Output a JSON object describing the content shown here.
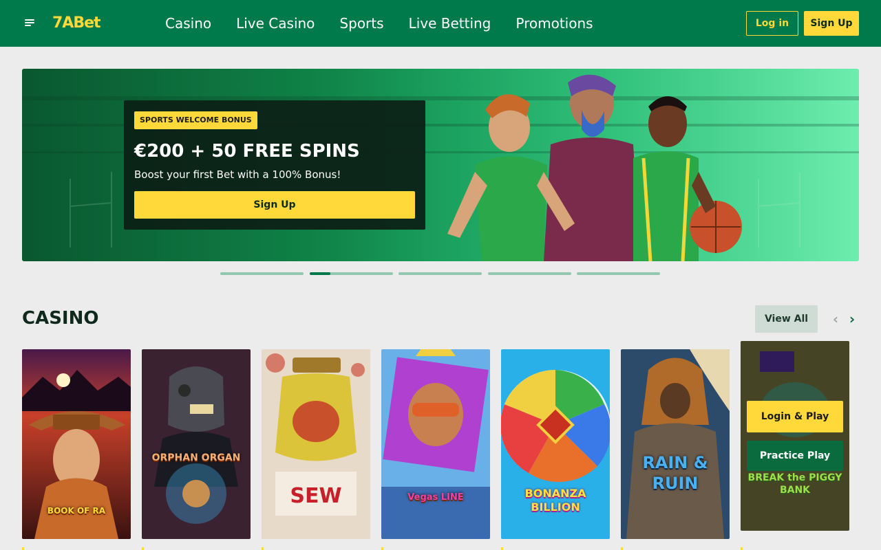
{
  "header": {
    "logo_num": "7A",
    "logo_text": "Bet",
    "nav": [
      "Casino",
      "Live Casino",
      "Sports",
      "Live Betting",
      "Promotions"
    ],
    "login_label": "Log in",
    "signup_label": "Sign Up"
  },
  "banner": {
    "badge": "SPORTS WELCOME BONUS",
    "title": "€200 + 50 FREE SPINS",
    "subtitle": "Boost your first Bet with a 100% Bonus!",
    "cta": "Sign Up",
    "slide_count": 5,
    "active_slide": 2,
    "active_slide_progress": 0.25
  },
  "casino": {
    "title": "CASINO",
    "view_all": "View All",
    "games": [
      {
        "name": "BOOK OF RA",
        "bg": "#7a2a2a"
      },
      {
        "name": "ORPHAN ORGAN",
        "bg": "#3a2230"
      },
      {
        "name": "SEW",
        "bg": "#e8dac8"
      },
      {
        "name": "Vegas LINE",
        "bg": "#3a5fc8"
      },
      {
        "name": "BONANZA BILLION",
        "bg": "#2ab0e8"
      },
      {
        "name": "RAIN & RUIN",
        "bg": "#2c4a6a"
      },
      {
        "name": "BREAK the PIGGY BANK",
        "bg": "#6b6a3a"
      }
    ],
    "hover_login_play": "Login & Play",
    "hover_practice_play": "Practice Play"
  },
  "colors": {
    "brand_green": "#007a4a",
    "accent_yellow": "#ffd83a"
  },
  "icons": {
    "menu": "menu-icon",
    "chevron_left": "chevron-left-icon",
    "chevron_right": "chevron-right-icon"
  }
}
